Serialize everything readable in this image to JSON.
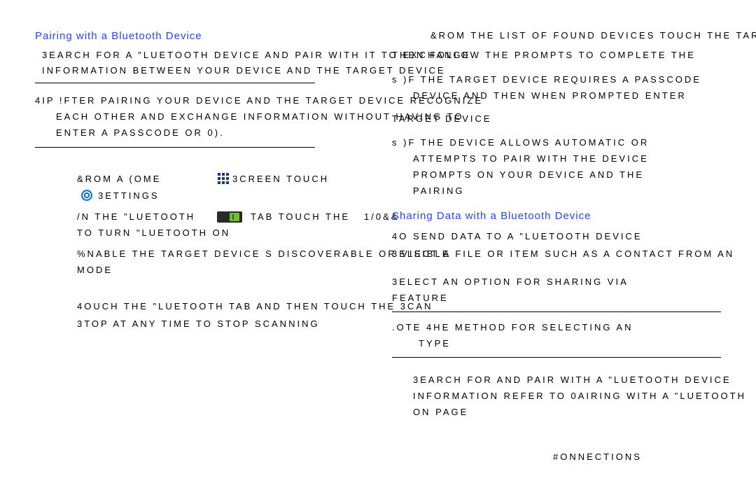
{
  "heading_pairing": "Pairing with a Bluetooth Device",
  "heading_sharing": "Sharing Data with a Bluetooth Device",
  "p1_l1": "3EARCH FOR A \"LUETOOTH DEVICE AND PAIR WITH IT TO EXCHANGE",
  "p1_l2": "INFORMATION BETWEEN YOUR DEVICE AND THE TARGET DEVICE",
  "tip_l1": "4IP !FTER PAIRING  YOUR DEVICE AND THE TARGET DEVICE RECOGNIZE",
  "tip_l2": "EACH OTHER AND EXCHANGE INFORMATION WITHOUT HAVING TO",
  "tip_l3": "ENTER A PASSCODE OR 0).",
  "step1_a": "&ROM A (OME",
  "step1_b": "  3CREEN  TOUCH",
  "step1_c": "    3ETTINGS",
  "step2_a": "/N THE \"LUETOOTH",
  "step2_b": "TAB  TOUCH THE",
  "step2_c": "   1/0&&",
  "step2_d": "TO TURN \"LUETOOTH ON",
  "step3_a": "%NABLE THE TARGET DEVICE S DISCOVERABLE OR VISIBLE",
  "step3_b": "MODE",
  "step4": "4OUCH THE \"LUETOOTH TAB  AND THEN TOUCH THE 3CAN",
  "step5": "3TOP AT ANY TIME TO STOP SCANNING",
  "r1_l1": "&ROM THE LIST OF FOUND DEVICES  TOUCH THE TARGET",
  "r1_l2": "THEN FOLLOW THE PROMPTS TO COMPLETE THE",
  "r1_l3": "s )F THE TARGET DEVICE REQUIRES A PASSCODE",
  "r1_l4": "DEVICE AND THEN  WHEN PROMPTED  ENTER",
  "r1_l5": "TARGET DEVICE",
  "r1_l6": "s )F THE DEVICE ALLOWS AUTOMATIC OR",
  "r1_l7": "ATTEMPTS TO PAIR WITH THE DEVICE",
  "r1_l8": "PROMPTS ON YOUR DEVICE AND THE",
  "r1_l9": "PAIRING",
  "r2_l1": "4O SEND DATA TO A \"LUETOOTH DEVICE",
  "r2_l2": "3ELECT A FILE OR ITEM  SUCH AS A CONTACT  FROM AN",
  "r2_l3": "3ELECT AN OPTION FOR SHARING VIA",
  "r2_l4": "FEATURE",
  "note_l1": ".OTE 4HE METHOD FOR SELECTING AN",
  "note_l2": "TYPE",
  "r3_l1": "3EARCH FOR AND PAIR WITH A \"LUETOOTH DEVICE",
  "r3_l2": "INFORMATION  REFER TO 0AIRING WITH A \"LUETOOTH",
  "r3_l3": "ON PAGE",
  "footer": "#ONNECTIONS"
}
